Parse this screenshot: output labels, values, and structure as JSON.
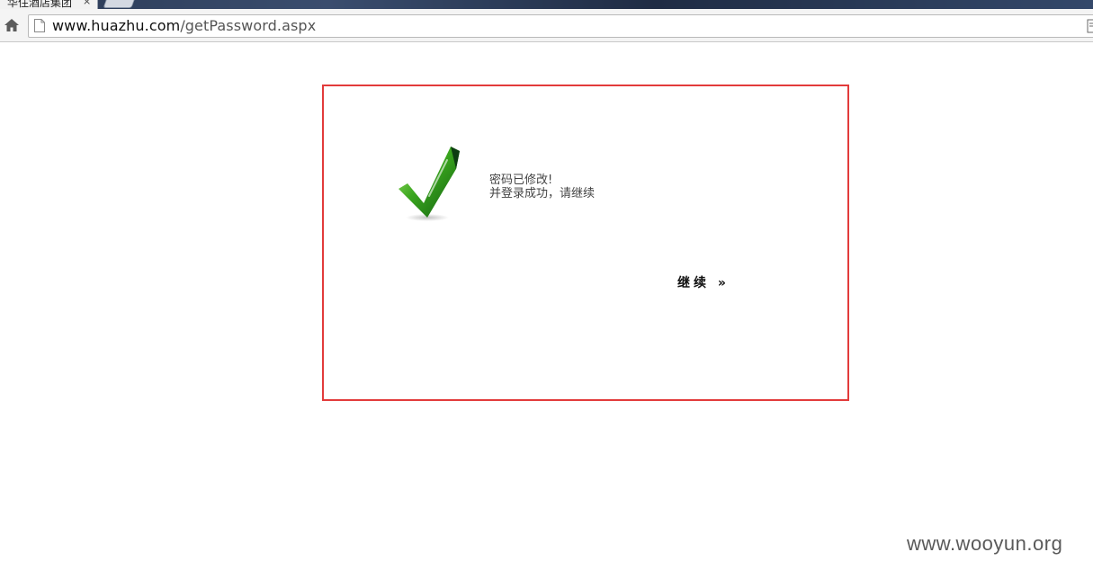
{
  "browser": {
    "tab_title": "华住酒店集团",
    "tab_close": "×",
    "url_host": "www.huazhu.com",
    "url_path": "/getPassword.aspx"
  },
  "icons": {
    "home": "home-icon",
    "page": "page-icon",
    "check": "checkmark-icon",
    "page_menu": "page-menu-icon"
  },
  "message": {
    "line1": "密码已修改!",
    "line2": "并登录成功，请继续"
  },
  "continue_label": "继续 »",
  "watermark": "www.wooyun.org",
  "colors": {
    "highlight_border": "#e23b3b",
    "check_green": "#2e9a1c"
  }
}
